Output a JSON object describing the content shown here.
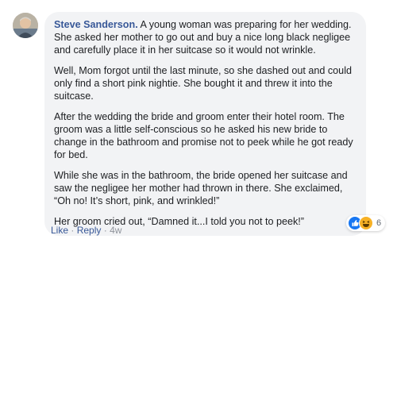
{
  "comment": {
    "author": "Steve Sanderson.",
    "paragraphs": [
      " A young woman was preparing for her wedding. She asked her mother to go out and buy a nice long black negligee and carefully place it in her suitcase so it would not wrinkle.",
      "Well, Mom forgot until the last minute, so she dashed out and could only find a short pink nightie. She bought it and threw it into the suitcase.",
      "After the wedding the bride and groom enter their hotel room. The groom was a little self-conscious so he asked his new bride to change in the bathroom and promise not to peek while he got ready for bed.",
      "While she was in the bathroom, the bride opened her suitcase and saw the negligee her mother had thrown in there. She exclaimed, “Oh no! It’s short, pink, and wrinkled!”",
      "Her groom cried out, “Damned it...I told you not to peek!”"
    ],
    "reactions": {
      "icons": [
        "like-icon",
        "haha-icon"
      ],
      "count": "6",
      "colors": {
        "like": "#1877f2",
        "haha": "#f7b125"
      }
    },
    "actions": {
      "like": "Like",
      "reply": "Reply",
      "separator": "·",
      "time": "4w"
    }
  },
  "colors": {
    "author": "#385898",
    "bubble_bg": "#f2f3f5",
    "text": "#1c1e21",
    "meta": "#90949c"
  }
}
